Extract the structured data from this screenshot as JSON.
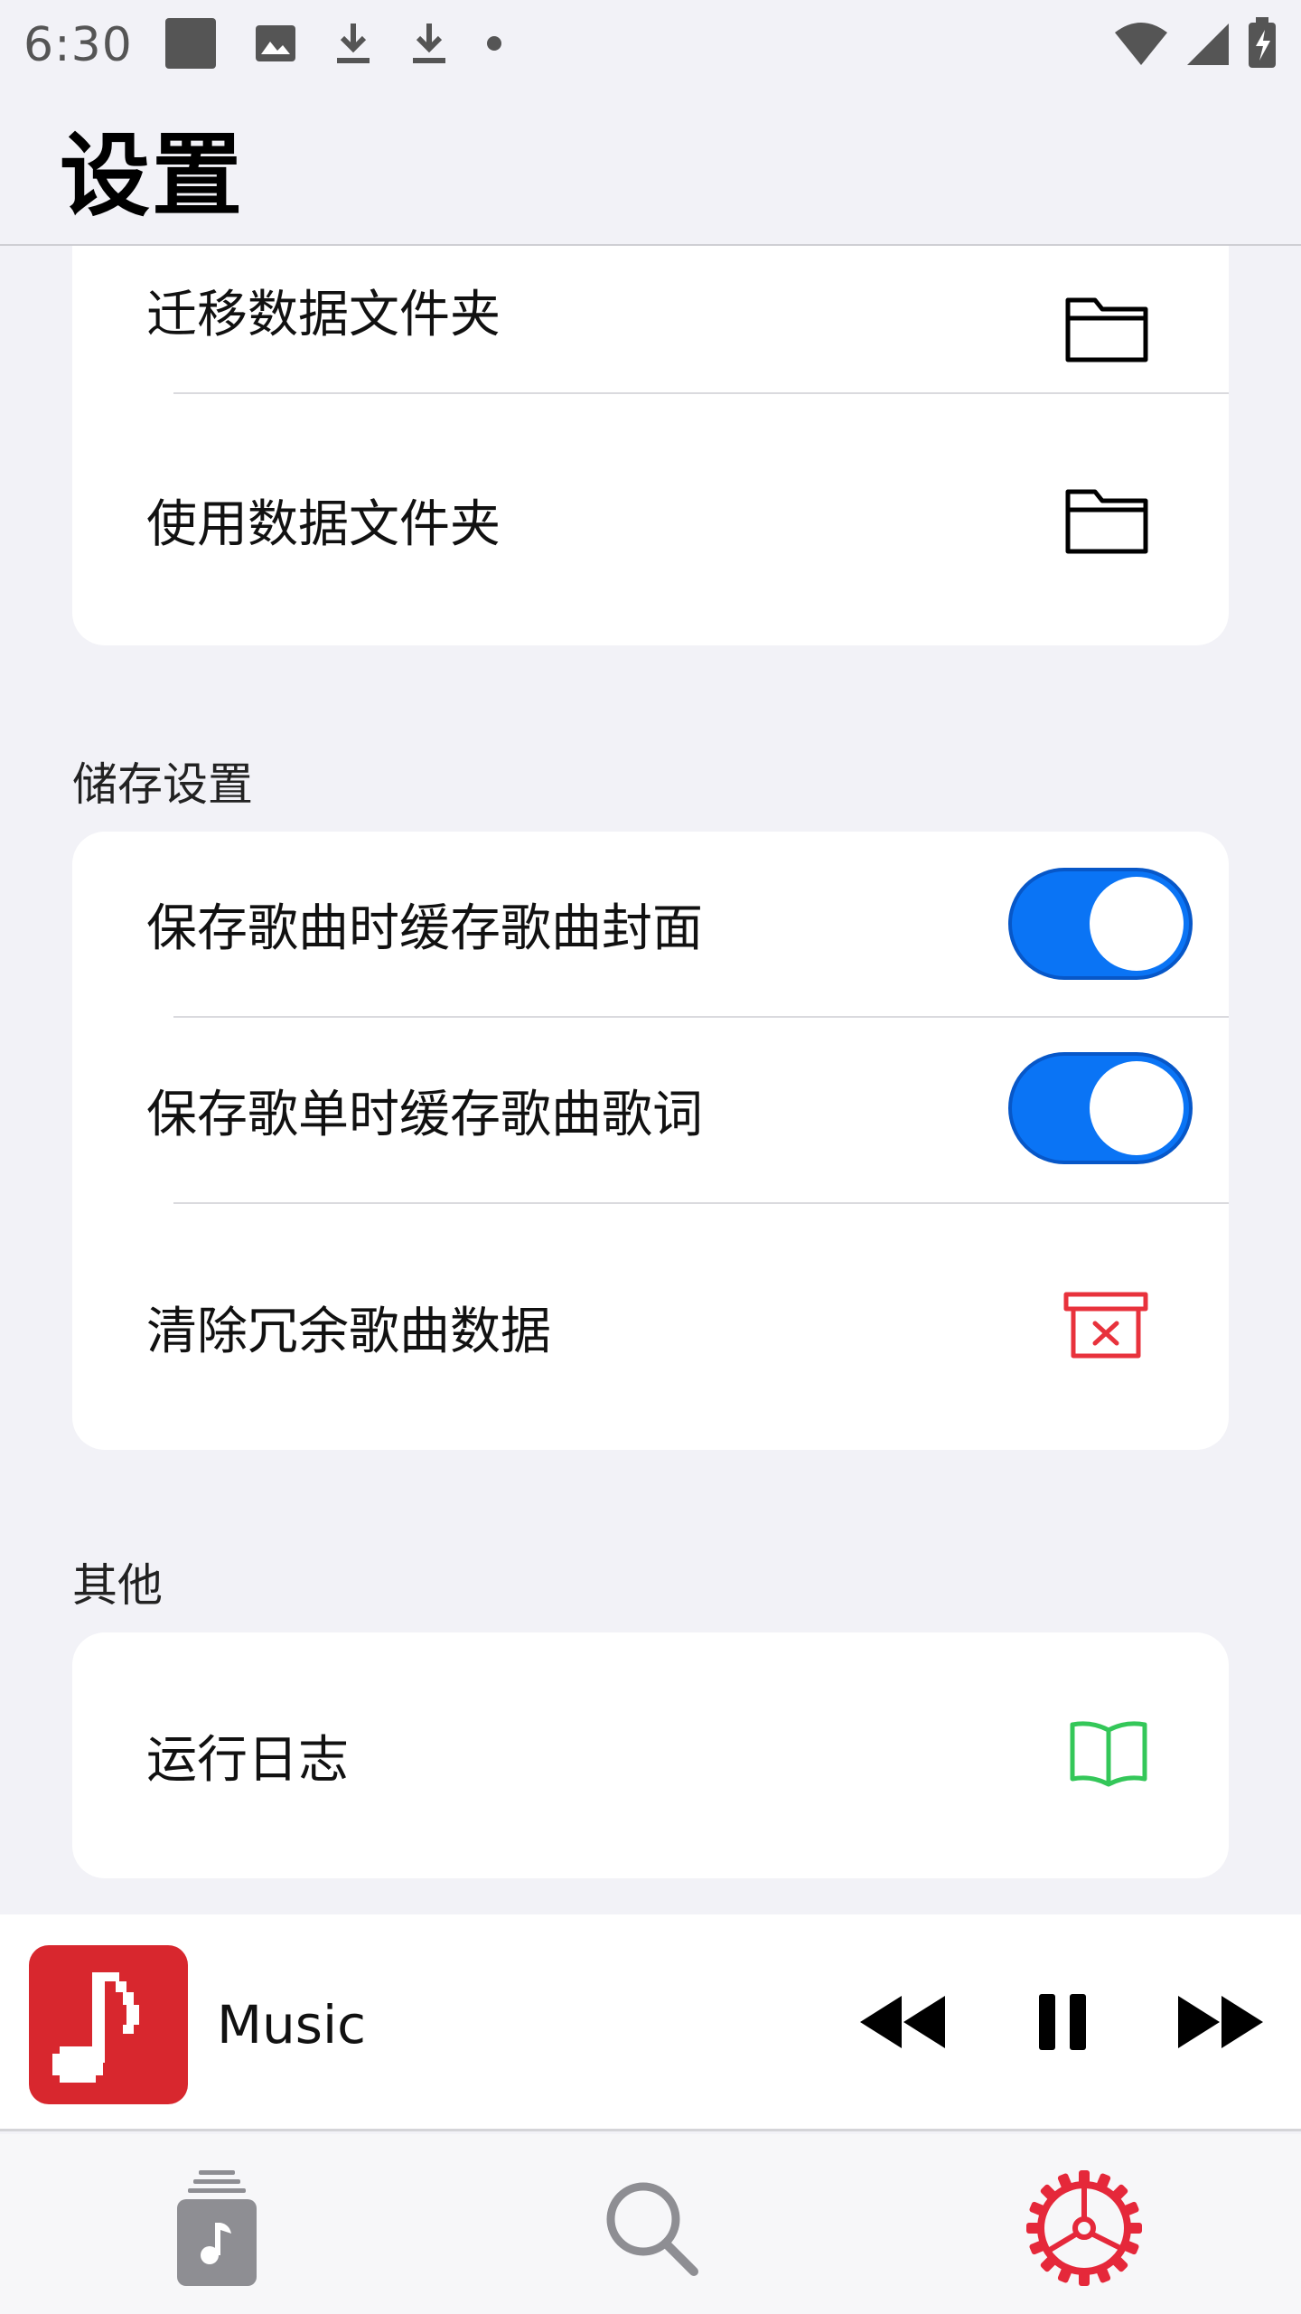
{
  "status_bar": {
    "time": "6:30"
  },
  "header": {
    "title": "设置"
  },
  "data_folder_card": {
    "rows": [
      {
        "label": "迁移数据文件夹",
        "icon": "folder-icon"
      },
      {
        "label": "使用数据文件夹",
        "icon": "folder-icon"
      }
    ]
  },
  "storage_section": {
    "title": "储存设置",
    "rows": [
      {
        "label": "保存歌曲时缓存歌曲封面",
        "toggle": true
      },
      {
        "label": "保存歌单时缓存歌曲歌词",
        "toggle": true
      },
      {
        "label": "清除冗余歌曲数据",
        "icon": "trash-x-icon"
      }
    ]
  },
  "other_section": {
    "title": "其他",
    "rows": [
      {
        "label": "运行日志",
        "icon": "book-icon"
      }
    ]
  },
  "player": {
    "track_title": "Music"
  },
  "tab_bar": {
    "tabs": [
      {
        "icon": "library-icon",
        "active": false
      },
      {
        "icon": "search-icon",
        "active": false
      },
      {
        "icon": "settings-icon",
        "active": true
      }
    ]
  },
  "colors": {
    "accent": "#0a74f5",
    "danger": "#e8323c",
    "success": "#34c759",
    "active_tab": "#e5283a",
    "background": "#f2f2f7"
  }
}
